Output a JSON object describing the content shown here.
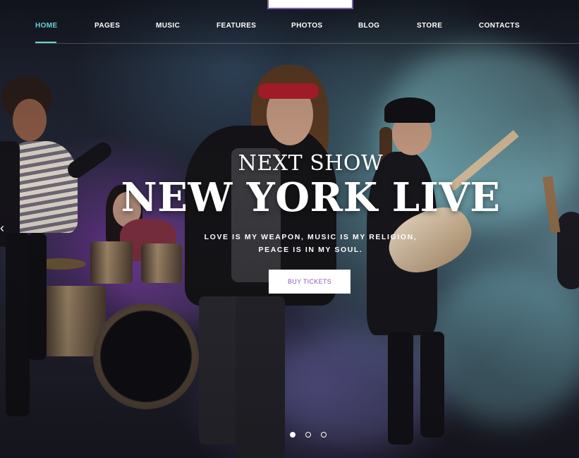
{
  "nav": {
    "items": [
      {
        "label": "HOME",
        "active": true
      },
      {
        "label": "PAGES",
        "active": false
      },
      {
        "label": "MUSIC",
        "active": false
      },
      {
        "label": "FEATURES",
        "active": false
      },
      {
        "label": "PHOTOS",
        "active": false
      },
      {
        "label": "BLOG",
        "active": false
      },
      {
        "label": "STORE",
        "active": false
      },
      {
        "label": "CONTACTS",
        "active": false
      }
    ],
    "active_color": "#6ad1d3"
  },
  "hero": {
    "kicker": "NEXT SHOW",
    "headline": "NEW YORK LIVE",
    "tagline_line1": "LOVE IS MY WEAPON, MUSIC IS MY RELIGION,",
    "tagline_line2": "PEACE IS IN MY SOUL.",
    "cta_label": "BUY TICKETS",
    "cta_text_color": "#8a5cb0"
  },
  "slider": {
    "prev_icon": "chevron-left-icon",
    "slide_count": 3,
    "active_slide": 1
  },
  "colors": {
    "accent": "#6ad1d3",
    "logo_border": "#7a5ea8"
  }
}
